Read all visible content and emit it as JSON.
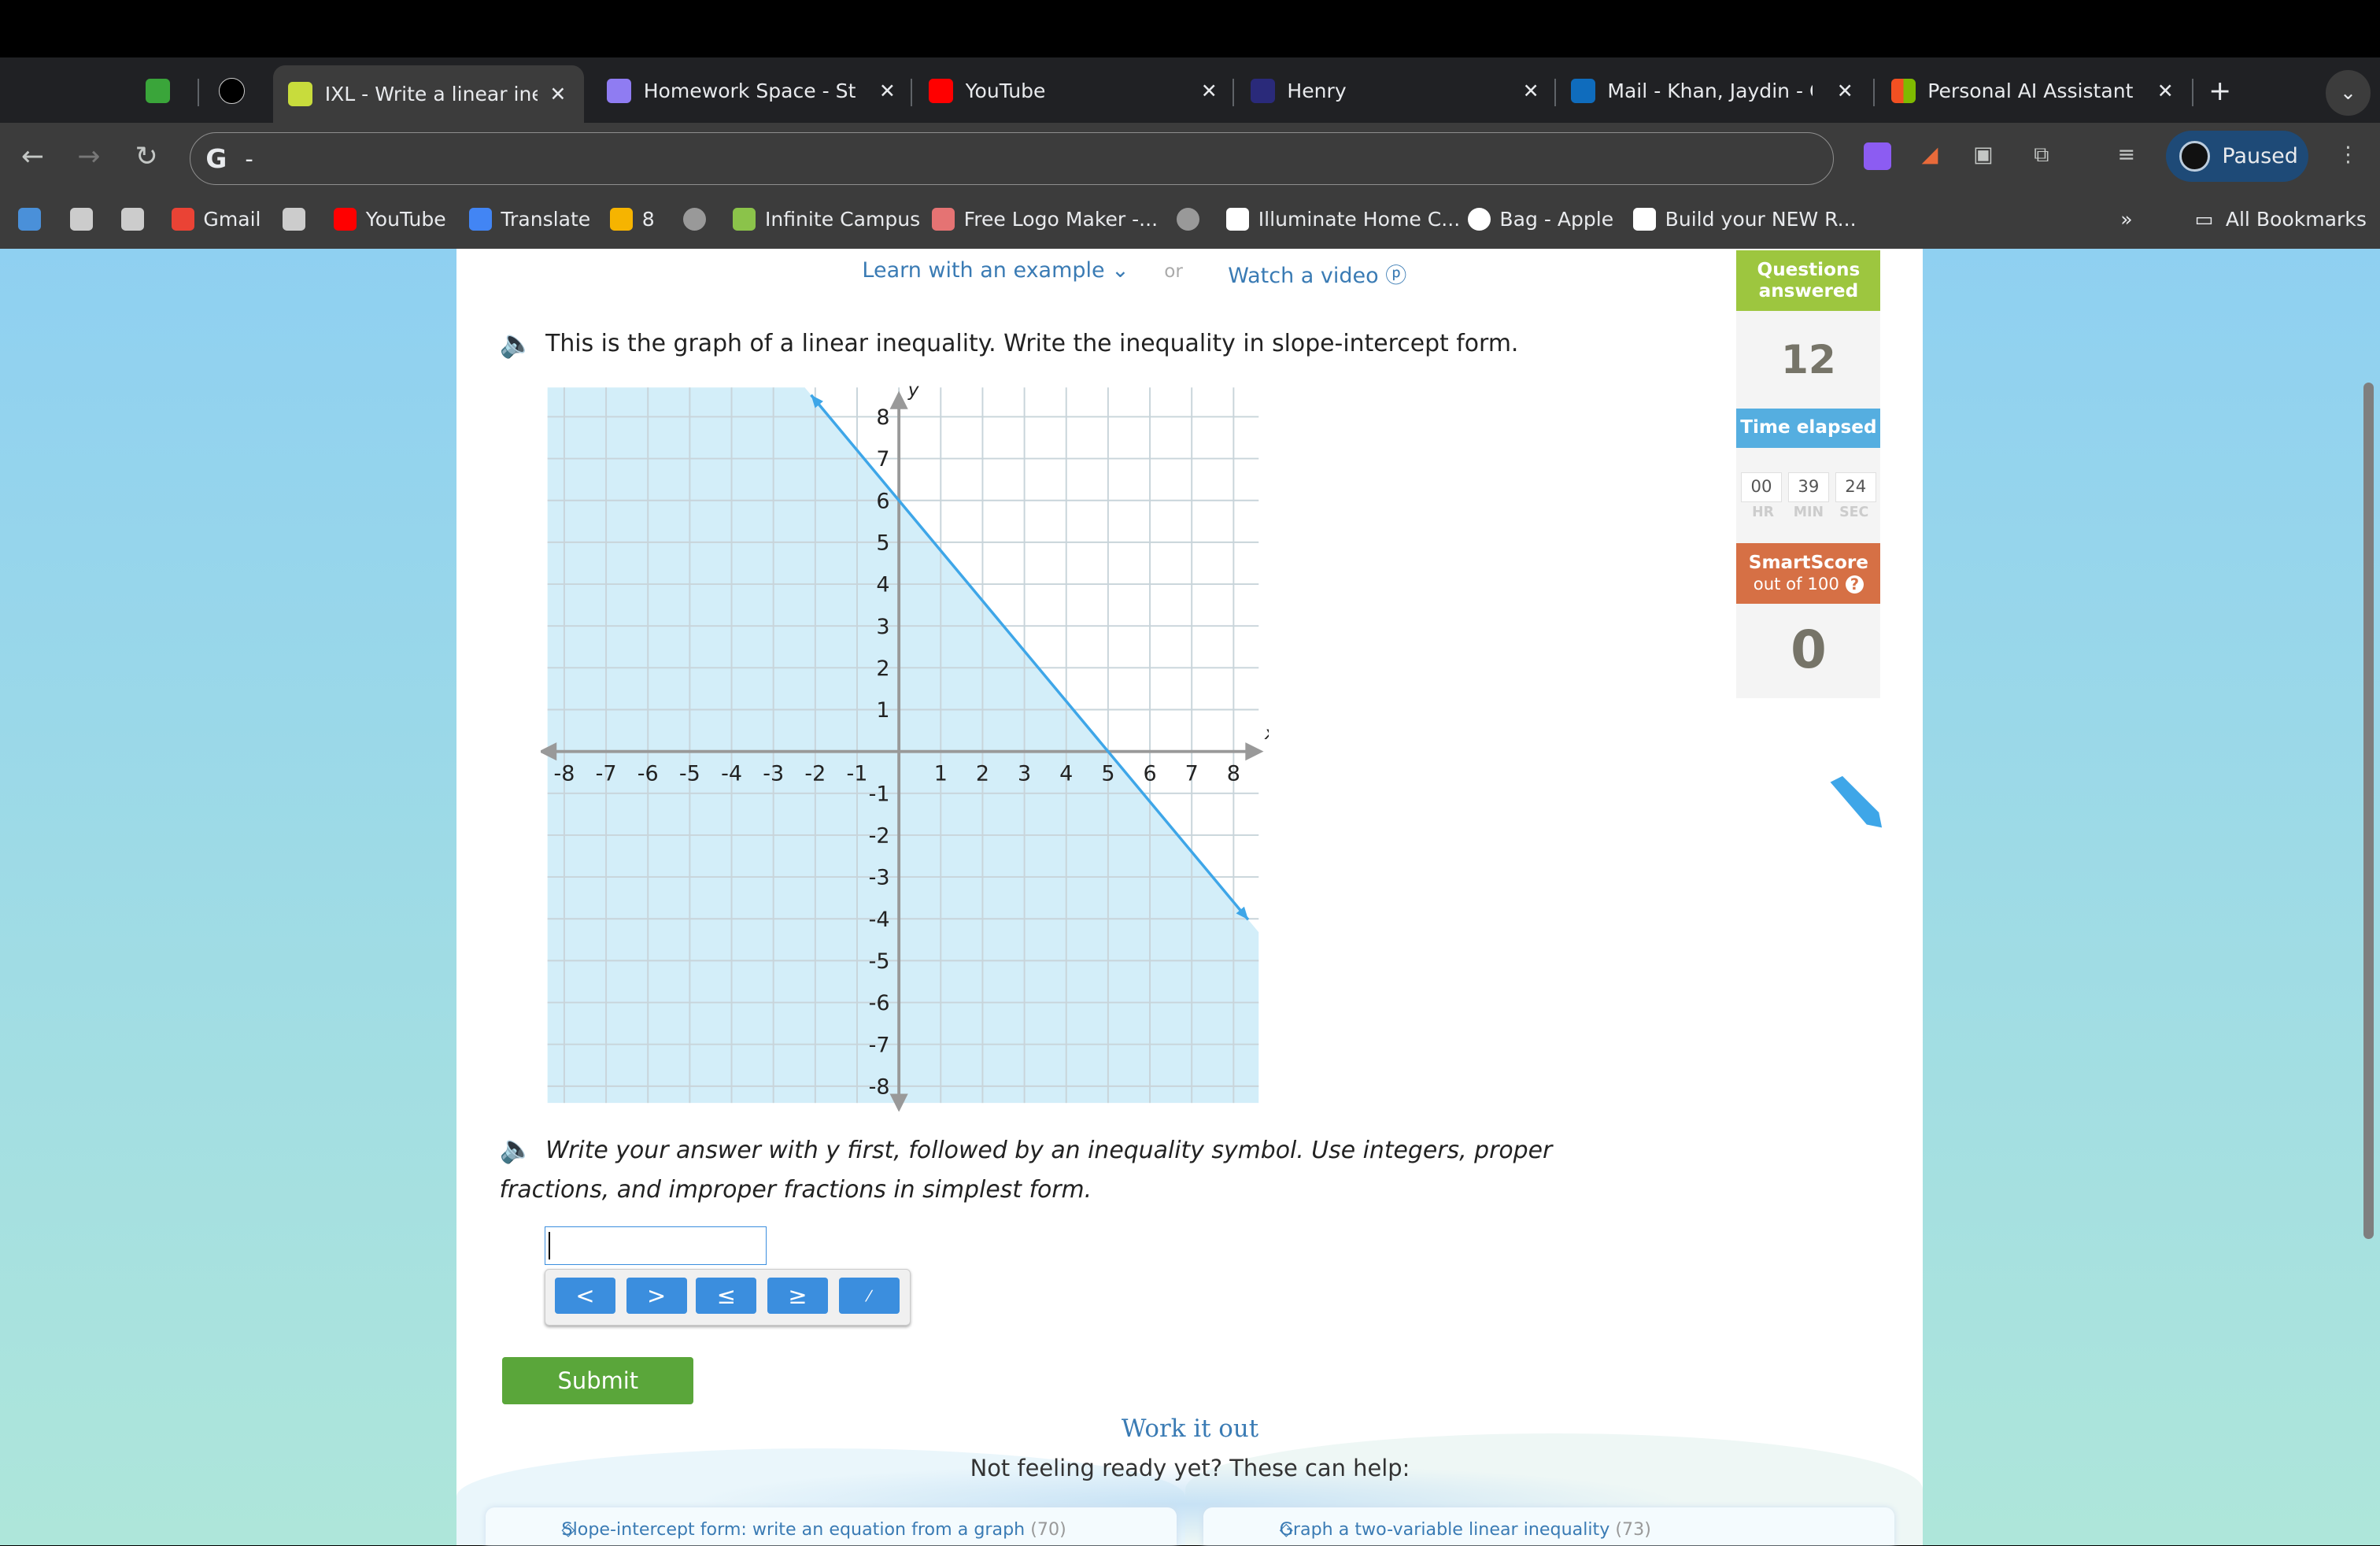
{
  "browser": {
    "tabs": [
      {
        "title": "IXL - Write a linear ineq",
        "active": true,
        "favicon_color": "#c8dc3c"
      },
      {
        "title": "Homework Space - Stu",
        "favicon_color": "#8f7cf2"
      },
      {
        "title": "YouTube",
        "favicon_color": "#ff0000"
      },
      {
        "title": "Henry",
        "favicon_color": "#2a2a7a"
      },
      {
        "title": "Mail - Khan, Jaydin - O",
        "favicon_color": "#0f6cbd"
      },
      {
        "title": "Personal AI Assistant |",
        "favicon_color": "#f25022"
      }
    ],
    "new_tab": "+",
    "address": "-",
    "profile_status": "Paused",
    "bookmarks": [
      {
        "label": "Gmail"
      },
      {
        "label": "YouTube"
      },
      {
        "label": "Translate"
      },
      {
        "label": "8"
      },
      {
        "label": "Infinite Campus"
      },
      {
        "label": "Free Logo Maker -..."
      },
      {
        "label": "Illuminate Home C..."
      },
      {
        "label": "Bag - Apple"
      },
      {
        "label": "Build your NEW R..."
      }
    ],
    "more_bookmarks": "»",
    "all_bookmarks": "All Bookmarks"
  },
  "ixl": {
    "learn_example": "Learn with an example",
    "or": "or",
    "watch_video": "Watch a video",
    "question": "This is the graph of a linear inequality. Write the inequality in slope-intercept form.",
    "instructions": "Write your answer with y first, followed by an inequality symbol. Use integers, proper fractions, and improper fractions in simplest form.",
    "answer_value": "",
    "keys": [
      "<",
      ">",
      "≤",
      "≥",
      "▯/▯"
    ],
    "submit": "Submit",
    "work_it_out": "Work it out",
    "not_ready": "Not feeling ready yet? These can help:",
    "help_cards": [
      {
        "title": "Slope-intercept form: write an equation from a graph",
        "count": "(70)"
      },
      {
        "title": "Graph a two-variable linear inequality",
        "count": "(73)"
      }
    ],
    "sidebar": {
      "questions_label": "Questions answered",
      "questions_value": "12",
      "time_label": "Time elapsed",
      "hr": "00",
      "min": "39",
      "sec": "24",
      "hr_label": "HR",
      "min_label": "MIN",
      "sec_label": "SEC",
      "smartscore_label": "SmartScore",
      "smartscore_sub": "out of 100",
      "smartscore_help": "?",
      "smartscore_value": "0",
      "colors": {
        "questions": "#9dc63f",
        "time": "#55aee0",
        "smartscore": "#d67045"
      }
    }
  },
  "chart_data": {
    "type": "line",
    "xlabel": "x",
    "ylabel": "y",
    "xlim": [
      -8,
      8
    ],
    "ylim": [
      -8,
      8
    ],
    "x_ticks": [
      -8,
      -7,
      -6,
      -5,
      -4,
      -3,
      -2,
      -1,
      1,
      2,
      3,
      4,
      5,
      6,
      7,
      8
    ],
    "y_ticks": [
      -8,
      -7,
      -6,
      -5,
      -4,
      -3,
      -2,
      -1,
      1,
      2,
      3,
      4,
      5,
      6,
      7,
      8
    ],
    "grid": true,
    "boundary_line": {
      "points": [
        [
          0,
          6
        ],
        [
          5,
          0
        ]
      ],
      "style": "solid",
      "color": "#3ea6e8"
    },
    "shaded_region": "below",
    "shade_color": "#d3eef9"
  }
}
